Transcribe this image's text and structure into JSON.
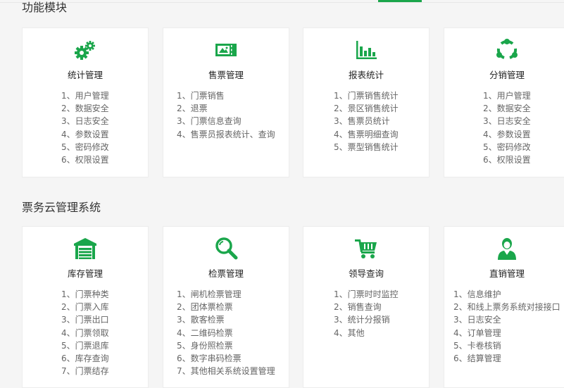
{
  "section1": {
    "title": "功能模块",
    "cards": [
      {
        "title": "统计管理",
        "icon": "gears-icon",
        "items": [
          "1、用户管理",
          "2、数据安全",
          "3、日志安全",
          "4、参数设置",
          "5、密码修改",
          "6、权限设置"
        ]
      },
      {
        "title": "售票管理",
        "icon": "ticket-icon",
        "items": [
          "1、门票销售",
          "2、退票",
          "3、门票信息查询",
          "4、售票员报表统计、查询"
        ]
      },
      {
        "title": "报表统计",
        "icon": "bar-chart-icon",
        "items": [
          "1、门票销售统计",
          "2、景区销售统计",
          "3、售票员统计",
          "4、售票明细查询",
          "5、票型销售统计"
        ]
      },
      {
        "title": "分销管理",
        "icon": "distribution-icon",
        "items": [
          "1、用户管理",
          "2、数据安全",
          "3、日志安全",
          "4、参数设置",
          "5、密码修改",
          "6、权限设置"
        ]
      }
    ]
  },
  "section2": {
    "title": "票务云管理系统",
    "cards": [
      {
        "title": "库存管理",
        "icon": "warehouse-icon",
        "items": [
          "1、门票种类",
          "2、门票入库",
          "3、门票出口",
          "4、门票领取",
          "5、门票退库",
          "6、库存查询",
          "7、门票结存"
        ]
      },
      {
        "title": "检票管理",
        "icon": "search-icon",
        "items": [
          "1、闸机检票管理",
          "2、团体票检票",
          "3、散客检票",
          "4、二维码检票",
          "5、身份照检票",
          "6、数字串码检票",
          "7、其他相关系统设置管理"
        ]
      },
      {
        "title": "领导查询",
        "icon": "shopping-cart-icon",
        "items": [
          "1、门票时时监控",
          "2、销售查询",
          "3、统计分报销",
          "4、其他"
        ]
      },
      {
        "title": "直销管理",
        "icon": "person-icon",
        "items": [
          "1、信息维护",
          "2、和线上票务系统对接接口",
          "3、日志安全",
          "4、订单管理",
          "5、卡卷核销",
          "6、结算管理"
        ]
      }
    ]
  },
  "colors": {
    "accent": "#1aa64b",
    "background": "#f5f5f5",
    "card": "#ffffff"
  }
}
